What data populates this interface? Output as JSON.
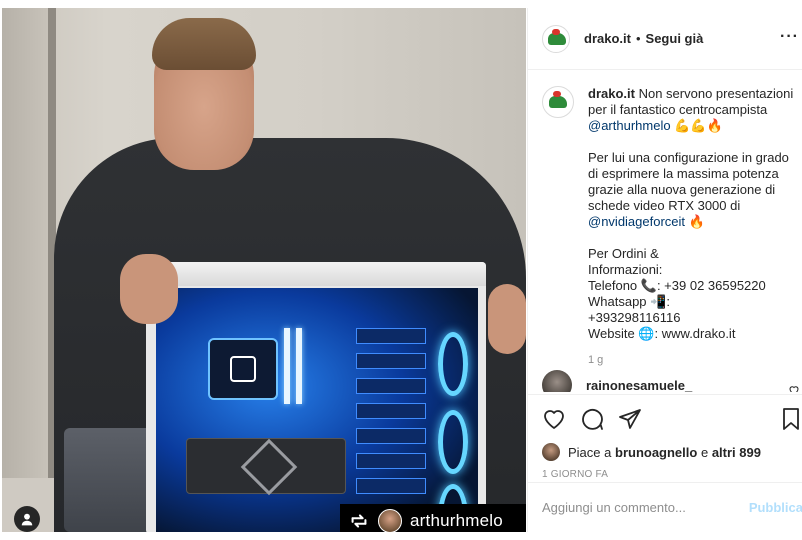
{
  "post": {
    "account": "drako.it",
    "separator": "•",
    "follow_label": "Segui già",
    "more_label": "···",
    "caption": {
      "username": "drako.it",
      "line1": "Non servono presentazioni per il fantastico centrocampista",
      "mention1": "@arthurhmelo",
      "emoji1": "💪💪🔥",
      "para2_a": "Per lui una configurazione in grado di esprimere la massima potenza grazie alla nuova generazione di schede video RTX 3000 di",
      "mention2": "@nvidiageforceit",
      "emoji2": "🔥",
      "contact_header": "Per Ordini &",
      "contact_header2": "Informazioni:",
      "phone": "Telefono 📞: +39 02 36595220",
      "whatsapp": "Whatsapp 📲:",
      "whatsapp_num": "+393298116116",
      "website": "Website 🌐: www.drako.it"
    },
    "caption_time": "1 g",
    "comment_user": "rainonesamuele_",
    "likes": {
      "prefix": "Piace a",
      "user": "brunoagnello",
      "middle": "e",
      "others": "altri 899"
    },
    "date": "1 GIORNO FA",
    "comment_placeholder": "Aggiungi un commento...",
    "publish_label": "Pubblica"
  },
  "photo": {
    "repost_user": "arthurhmelo"
  },
  "icons": {
    "like": "heart-icon",
    "comment": "comment-icon",
    "share": "share-icon",
    "save": "bookmark-icon",
    "repost": "repost-icon",
    "user_tag": "user-icon"
  },
  "colors": {
    "link": "#00376b",
    "muted": "#8e8e8e",
    "publish_disabled": "#b2dffc",
    "repost_bg": "#000000"
  }
}
